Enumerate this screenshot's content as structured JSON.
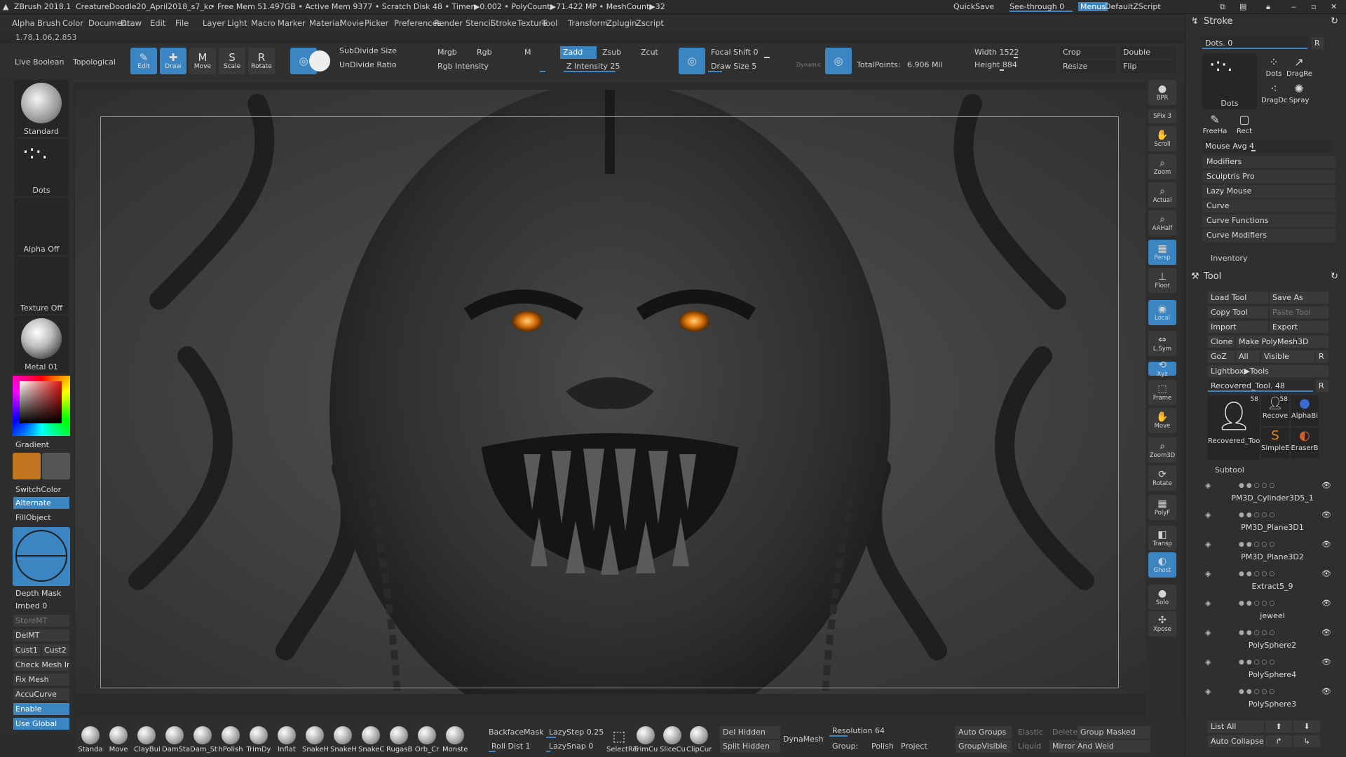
{
  "titlebar": {
    "app": "ZBrush 2018.1",
    "file": "CreatureDoodle20_April2018_s7_kc",
    "stats": "• Free Mem 51.497GB • Active Mem 9377 • Scratch Disk 48 • Timer▶0.002 • PolyCount▶71.422 MP • MeshCount▶32",
    "quicksave": "QuickSave",
    "seethrough": "See-through",
    "seethrough_value": "0",
    "menus": "Menus",
    "script": "DefaultZScript"
  },
  "menubar": [
    "Alpha",
    "Brush",
    "Color",
    "Document",
    "Draw",
    "Edit",
    "File",
    "Layer",
    "Light",
    "Macro",
    "Marker",
    "Material",
    "Movie",
    "Picker",
    "Preferences",
    "Render",
    "Stencil",
    "Stroke",
    "Texture",
    "Tool",
    "Transform",
    "Zplugin",
    "Zscript"
  ],
  "coords": "1.78,1.06,2.853",
  "topshelf": {
    "live_boolean": "Live Boolean",
    "topological": "Topological",
    "tools": [
      {
        "label": "Edit",
        "icon": "✎",
        "on": true
      },
      {
        "label": "Draw",
        "icon": "✚",
        "on": true
      },
      {
        "label": "Move",
        "icon": "M",
        "on": false
      },
      {
        "label": "Scale",
        "icon": "S",
        "on": false
      },
      {
        "label": "Rotate",
        "icon": "R",
        "on": false
      }
    ],
    "subdivide_size": "SubDivide Size",
    "undivide_ratio": "UnDivide Ratio",
    "mrgb": "Mrgb",
    "rgb": "Rgb",
    "m": "M",
    "rgb_intensity": "Rgb Intensity",
    "zadd": "Zadd",
    "zsub": "Zsub",
    "zcut": "Zcut",
    "z_intensity": "Z Intensity 25",
    "focal_shift": "Focal Shift 0",
    "draw_size": "Draw Size 5",
    "dynamic": "Dynamic",
    "total_points_label": "TotalPoints:",
    "total_points": "6.906 Mil",
    "width": "Width 1522",
    "height": "Height 884",
    "crop": "Crop",
    "resize": "Resize",
    "double": "Double",
    "flip": "Flip"
  },
  "left": {
    "standard": "Standard",
    "dots": "Dots",
    "alpha_off": "Alpha Off",
    "texture_off": "Texture Off",
    "metal": "Metal 01",
    "gradient": "Gradient",
    "switchcolor": "SwitchColor",
    "alternate": "Alternate",
    "fillobject": "FillObject",
    "depth_mask": "Depth Mask",
    "imbed": "Imbed 0",
    "storemt": "StoreMT",
    "delmt": "DelMT",
    "cust1": "Cust1",
    "cust2": "Cust2",
    "check_mesh": "Check Mesh In",
    "fix_mesh": "Fix Mesh",
    "accucurve": "AccuCurve",
    "enable": "Enable",
    "use_global": "Use Global",
    "colors": {
      "main": "#c0751e",
      "secondary": "#555555"
    }
  },
  "rightnav": [
    {
      "label": "BPR",
      "icon": "●",
      "on": false
    },
    {
      "label": "SPix 3",
      "icon": "",
      "on": false
    },
    {
      "label": "Scroll",
      "icon": "✋",
      "on": false
    },
    {
      "label": "Zoom",
      "icon": "⌕",
      "on": false
    },
    {
      "label": "Actual",
      "icon": "⌕",
      "on": false
    },
    {
      "label": "AAHalf",
      "icon": "⌕",
      "on": false
    },
    {
      "label": "Persp",
      "icon": "▦",
      "on": true
    },
    {
      "label": "Floor",
      "icon": "⊥",
      "on": false
    },
    {
      "label": "Local",
      "icon": "◉",
      "on": true
    },
    {
      "label": "L.Sym",
      "icon": "⇔",
      "on": false
    },
    {
      "label": "Xyz",
      "icon": "⟲",
      "on": true
    },
    {
      "label": "Frame",
      "icon": "⬚",
      "on": false
    },
    {
      "label": "Move",
      "icon": "✋",
      "on": false
    },
    {
      "label": "Zoom3D",
      "icon": "⌕",
      "on": false
    },
    {
      "label": "Rotate",
      "icon": "⟳",
      "on": false
    },
    {
      "label": "PolyF",
      "icon": "▦",
      "on": false
    },
    {
      "label": "Transp",
      "icon": "◧",
      "on": false
    },
    {
      "label": "Ghost",
      "icon": "◐",
      "on": true
    },
    {
      "label": "Solo",
      "icon": "●",
      "on": false
    },
    {
      "label": "Xpose",
      "icon": "✣",
      "on": false
    }
  ],
  "stroke": {
    "title": "Stroke",
    "dots_count": "Dots. 0",
    "r": "R",
    "items": [
      "Dots",
      "DragRe",
      "DragDc",
      "Spray",
      "FreeHa",
      "Rect"
    ],
    "main_thumb": "Dots",
    "mouse_avg": "Mouse Avg 4",
    "subpanels": [
      "Modifiers",
      "Sculptris Pro",
      "Lazy Mouse",
      "Curve",
      "Curve Functions",
      "Curve Modifiers"
    ],
    "inventory": "Inventory"
  },
  "tool": {
    "title": "Tool",
    "load": "Load Tool",
    "save_as": "Save As",
    "copy": "Copy Tool",
    "paste": "Paste Tool",
    "import": "Import",
    "export": "Export",
    "clone": "Clone",
    "make_polymesh": "Make PolyMesh3D",
    "goz": "GoZ",
    "all": "All",
    "visible": "Visible",
    "r": "R",
    "lightbox": "Lightbox▶Tools",
    "recovered": "Recovered_Tool. 48",
    "thumbs": [
      {
        "label": "Recovered_Too",
        "count": "58"
      },
      {
        "label": "Recove",
        "count": "58"
      },
      {
        "label": "AlphaBi",
        "count": ""
      },
      {
        "label": "SimpleE",
        "count": ""
      },
      {
        "label": "EraserB",
        "count": ""
      }
    ],
    "subtool_title": "Subtool",
    "subtools": [
      "PM3D_Cylinder3D5_1",
      "PM3D_Plane3D1",
      "PM3D_Plane3D2",
      "Extract5_9",
      "jeweel",
      "PolySphere2",
      "PolySphere4",
      "PolySphere3"
    ],
    "list_all": "List All",
    "auto_collapse": "Auto Collapse"
  },
  "bottom": {
    "brushes": [
      "Standa",
      "Move",
      "ClayBui",
      "DamSta",
      "Dam_St",
      "hPolish",
      "TrimDy",
      "Inflat",
      "SnakeH",
      "SnakeH",
      "SnakeC",
      "RugasB",
      "Orb_Cr",
      "Monste"
    ],
    "backface": "BackfaceMask",
    "lazystep": "LazyStep 0.25",
    "roll_dist": "Roll Dist 1",
    "lazysnap": "LazySnap 0",
    "select": "SelectRe",
    "trim": "TrimCu",
    "slice": "SliceCu",
    "clip": "ClipCur",
    "del_hidden": "Del Hidden",
    "split_hidden": "Split Hidden",
    "dynamesh": "DynaMesh",
    "resolution": "Resolution 64",
    "group": "Group:",
    "polish": "Polish",
    "project": "Project",
    "auto_groups": "Auto Groups",
    "elastic": "Elastic",
    "delete": "Delete",
    "group_masked": "Group Masked",
    "group_visible": "GroupVisible",
    "liquid": "Liquid",
    "mirror_weld": "Mirror And Weld"
  }
}
